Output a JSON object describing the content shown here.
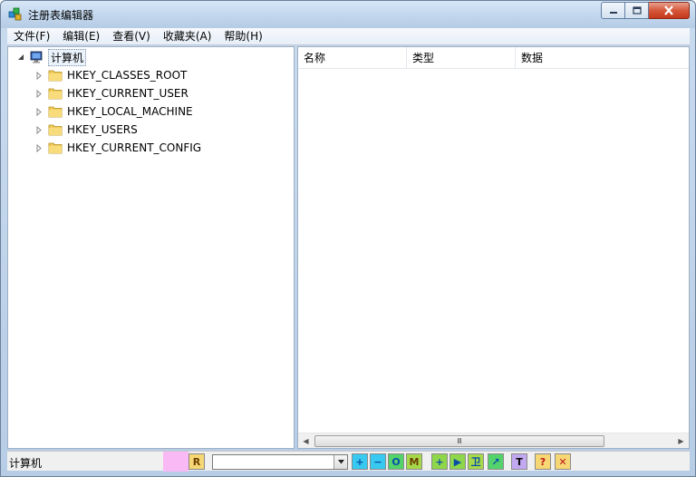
{
  "window": {
    "title": "注册表编辑器"
  },
  "menu": [
    {
      "label": "文件(F)"
    },
    {
      "label": "编辑(E)"
    },
    {
      "label": "查看(V)"
    },
    {
      "label": "收藏夹(A)"
    },
    {
      "label": "帮助(H)"
    }
  ],
  "tree": {
    "root": {
      "label": "计算机",
      "icon": "computer-icon",
      "expanded": true
    },
    "children": [
      {
        "label": "HKEY_CLASSES_ROOT",
        "icon": "folder-icon"
      },
      {
        "label": "HKEY_CURRENT_USER",
        "icon": "folder-icon"
      },
      {
        "label": "HKEY_LOCAL_MACHINE",
        "icon": "folder-icon"
      },
      {
        "label": "HKEY_USERS",
        "icon": "folder-icon"
      },
      {
        "label": "HKEY_CURRENT_CONFIG",
        "icon": "folder-icon"
      }
    ]
  },
  "list": {
    "columns": [
      {
        "label": "名称"
      },
      {
        "label": "类型"
      },
      {
        "label": "数据"
      }
    ],
    "scroll_grip": "Ⅲ"
  },
  "status": {
    "path": "计算机",
    "search_value": ""
  },
  "toolbar": {
    "buttons": [
      {
        "glyph": "R",
        "name": "r-icon",
        "color": "#6b3f00",
        "bg": "#f6d774"
      },
      {
        "glyph": "+",
        "name": "plus-icon",
        "color": "#0a4ea8",
        "bg": "#38c9f0"
      },
      {
        "glyph": "−",
        "name": "minus-icon",
        "color": "#0a4ea8",
        "bg": "#38c9f0"
      },
      {
        "glyph": "O",
        "name": "o-icon",
        "color": "#0a4ea8",
        "bg": "#55d36b"
      },
      {
        "glyph": "M",
        "name": "m-icon",
        "color": "#6b3f00",
        "bg": "#a6d84a"
      },
      {
        "glyph": "+",
        "name": "add-green-icon",
        "color": "#0a4ea8",
        "bg": "#8ed64a"
      },
      {
        "glyph": "▶",
        "name": "play-icon",
        "color": "#0a4ea8",
        "bg": "#8ed64a"
      },
      {
        "glyph": "卫",
        "name": "wei-icon",
        "color": "#0a4ea8",
        "bg": "#a6d84a"
      },
      {
        "glyph": "↗",
        "name": "arrow-icon",
        "color": "#0a4ea8",
        "bg": "#55d36b"
      },
      {
        "glyph": "T",
        "name": "t-icon",
        "color": "#0a0a0a",
        "bg": "#c2a8f0"
      },
      {
        "glyph": "?",
        "name": "help-red-icon",
        "color": "#c01818",
        "bg": "#f6d774"
      },
      {
        "glyph": "✕",
        "name": "close-red-icon",
        "color": "#c01818",
        "bg": "#f6d774"
      }
    ]
  },
  "colors": {
    "accent": "#3c7fc4",
    "close_button": "#c4391b"
  }
}
